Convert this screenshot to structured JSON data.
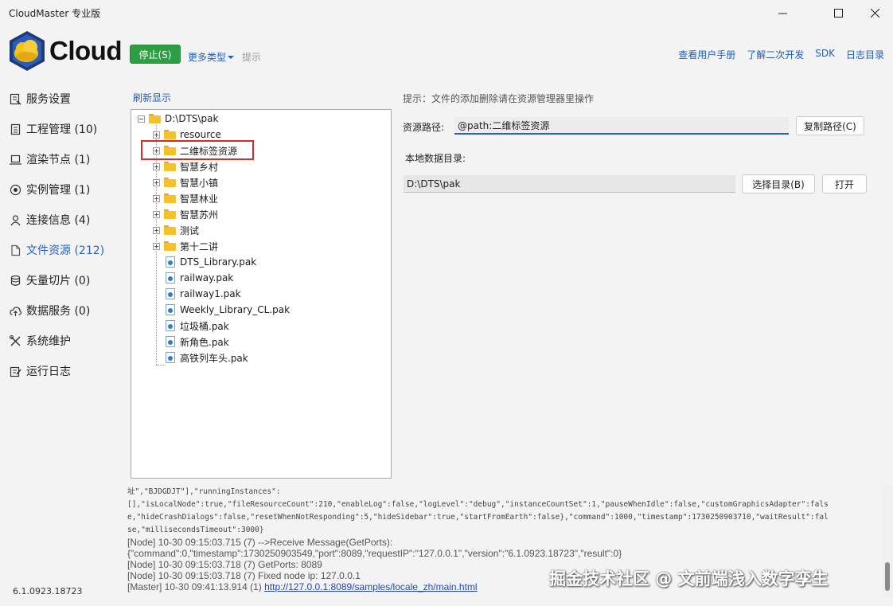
{
  "window": {
    "title": "CloudMaster 专业版"
  },
  "header": {
    "brand": "Cloud",
    "stop_label": "停止(S)",
    "more_types_label": "更多类型",
    "hint_label": "提示",
    "links": [
      "查看用户手册",
      "了解二次开发",
      "SDK",
      "日志目录"
    ]
  },
  "sidebar": {
    "items": [
      {
        "label": "服务设置",
        "icon": "settings-doc-icon"
      },
      {
        "label": "工程管理 (10)",
        "icon": "document-icon"
      },
      {
        "label": "渲染节点 (1)",
        "icon": "laptop-icon"
      },
      {
        "label": "实例管理 (1)",
        "icon": "target-icon"
      },
      {
        "label": "连接信息 (4)",
        "icon": "user-icon"
      },
      {
        "label": "文件资源 (212)",
        "icon": "file-icon"
      },
      {
        "label": "矢量切片 (0)",
        "icon": "database-icon"
      },
      {
        "label": "数据服务 (0)",
        "icon": "cloud-upload-icon"
      },
      {
        "label": "系统维护",
        "icon": "tools-icon"
      },
      {
        "label": "运行日志",
        "icon": "log-icon"
      }
    ],
    "active_index": 5,
    "version": "6.1.0923.18723"
  },
  "tree": {
    "refresh_label": "刷新显示",
    "root": "D:\\DTS\\pak",
    "folders": [
      "resource",
      "二维标签资源",
      "智慧乡村",
      "智慧小镇",
      "智慧林业",
      "智慧苏州",
      "测试",
      "第十二讲"
    ],
    "files": [
      "DTS_Library.pak",
      "railway.pak",
      "railway1.pak",
      "Weekly_Library_CL.pak",
      "垃圾桶.pak",
      "新角色.pak",
      "高铁列车头.pak"
    ]
  },
  "details": {
    "tip": "提示：文件的添加删除请在资源管理器里操作",
    "resource_path_label": "资源路径:",
    "resource_path_value": "@path:二维标签资源",
    "copy_path_label": "复制路径(C)",
    "local_dir_label": "本地数据目录:",
    "local_dir_value": "D:\\DTS\\pak",
    "choose_dir_label": "选择目录(B)",
    "open_label": "打开"
  },
  "log": {
    "mono_lines": [
      "址\",\"BJDGDJT\"],\"runningInstances\":",
      "[],\"isLocalNode\":true,\"fileResourceCount\":210,\"enableLog\":false,\"logLevel\":\"debug\",\"instanceCountSet\":1,\"pauseWhenIdle\":false,\"customGraphicsAdapter\":fals",
      "e,\"hideCrashDialogs\":false,\"resetWhenNotResponding\":5,\"hideSidebar\":true,\"startFromEarth\":false},\"command\":1000,\"timestamp\":1730250903710,\"waitResult\":fal",
      "se,\"millisecondsTimeout\":3000}"
    ],
    "lines": [
      "[Node] 10-30 09:15:03.715 (7) -->Receive Message(GetPorts):",
      "{\"command\":0,\"timestamp\":1730250903549,\"port\":8089,\"requestIP\":\"127.0.0.1\",\"version\":\"6.1.0923.18723\",\"result\":0}",
      "[Node] 10-30 09:15:03.718 (7) GetPorts: 8089",
      "[Node] 10-30 09:15:03.718 (7) Fixed node ip: 127.0.0.1"
    ],
    "last_prefix": "[Master] 10-30 09:41:13.914 (1) ",
    "last_link": "http://127.0.0.1:8089/samples/locale_zh/main.html"
  },
  "watermark": "掘金技术社区 @ 文前端浅入数字孪生",
  "colors": {
    "accent": "#2a62c4",
    "stop_button": "#2e9e45",
    "highlight": "#d62b2b",
    "folder": "#f4c12c"
  }
}
